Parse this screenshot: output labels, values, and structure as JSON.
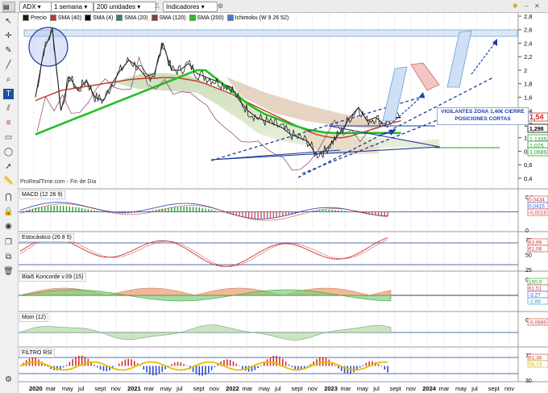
{
  "toolbar": {
    "symbol": "ADX",
    "period": "1 semana",
    "units": "200 unidades",
    "indicators_label": "Indicadores"
  },
  "legend": [
    "Precio",
    "SMA (40)",
    "SMA (4)",
    "SMA (20)",
    "SMA (120)",
    "SMA (200)",
    "Ichimoku (W 9 26 52)"
  ],
  "legend_colors": [
    "#1a1a1a",
    "#c0392b",
    "#000000",
    "#2e8b57",
    "#8b3a3a",
    "#22c022",
    "#3a7fd0"
  ],
  "annotation": {
    "line1": "VIGILANTES ZONA 1,40€ CIERRE",
    "line2": "POSICIONES CORTAS"
  },
  "source_label": "ProRealTime.com - Fin de Día",
  "price_axis": [
    "2,8",
    "2,6",
    "2,4",
    "2,2",
    "2",
    "1,8",
    "1,6",
    "1,4",
    "1,2",
    "1",
    "0,8",
    "0,6",
    "0,4"
  ],
  "price_tags": [
    {
      "text": "1,54",
      "color": "#d03030"
    },
    {
      "text": "1,298",
      "color": "#000000"
    },
    {
      "text": "1,1335",
      "color": "#22a022"
    },
    {
      "text": "1,075",
      "color": "#22a022"
    },
    {
      "text": "1,0689",
      "color": "#22a022"
    }
  ],
  "panels": [
    {
      "title": "MACD (12 26 9)",
      "axis": [
        "0,1",
        "0"
      ],
      "tags": [
        "0,0434",
        "0,0415",
        "-0,0019"
      ],
      "tag_colors": [
        "#cc3333",
        "#3355cc",
        "#cc3333"
      ]
    },
    {
      "title": "Estocástico (26 8 5)",
      "axis": [
        "75",
        "50",
        "25"
      ],
      "tags": [
        "63,99",
        "61,06"
      ],
      "tag_colors": [
        "#cc3333",
        "#cc3333"
      ]
    },
    {
      "title": "Blai5 Koncorde v.09 (15)",
      "axis": [
        "0"
      ],
      "tags": [
        "100,0",
        "61,51",
        "-3,27",
        "-2,88"
      ],
      "tag_colors": [
        "#22a022",
        "#cc3333",
        "#3355cc",
        "#2a9ad0"
      ]
    },
    {
      "title": "Mom (12)",
      "axis": [
        "0"
      ],
      "tags": [
        "-0,0689"
      ],
      "tag_colors": [
        "#cc3333"
      ]
    },
    {
      "title": "FILTRO RSI",
      "axis": [
        "70",
        "30"
      ],
      "tags": [
        "61,36",
        "59,73"
      ],
      "tag_colors": [
        "#cc3333",
        "#c8b400"
      ]
    }
  ],
  "time_axis": [
    "2020",
    "mar",
    "may",
    "jul",
    "sept",
    "nov",
    "2021",
    "mar",
    "may",
    "jul",
    "sept",
    "nov",
    "2022",
    "mar",
    "may",
    "jul",
    "sept",
    "nov",
    "2023",
    "mar",
    "may",
    "jul",
    "sept",
    "nov",
    "2024",
    "mar",
    "may",
    "jul",
    "sept",
    "nov"
  ],
  "chart_data": {
    "type": "line",
    "title": "ADX",
    "xlabel": "",
    "ylabel": "",
    "ylim": [
      0.4,
      2.8
    ],
    "grid": true,
    "x": [
      "2020-01",
      "2020-02",
      "2020-03",
      "2020-04",
      "2020-05",
      "2020-06",
      "2020-07",
      "2020-08",
      "2020-09",
      "2020-10",
      "2020-11",
      "2020-12",
      "2021-01",
      "2021-02",
      "2021-03",
      "2021-04",
      "2021-05",
      "2021-06",
      "2021-07",
      "2021-08",
      "2021-09",
      "2021-10",
      "2021-11",
      "2021-12",
      "2022-01",
      "2022-02",
      "2022-03",
      "2022-04",
      "2022-05",
      "2022-06",
      "2022-07",
      "2022-08",
      "2022-09",
      "2022-10",
      "2022-11",
      "2022-12",
      "2023-01",
      "2023-02",
      "2023-03",
      "2023-04",
      "2023-05",
      "2023-06",
      "2023-07",
      "2023-08"
    ],
    "series": [
      {
        "name": "Precio",
        "values": [
          1.6,
          2.3,
          2.6,
          1.4,
          1.9,
          1.7,
          1.85,
          1.6,
          1.55,
          1.8,
          2.0,
          2.15,
          2.05,
          1.9,
          1.95,
          2.4,
          2.0,
          2.0,
          2.1,
          1.95,
          1.9,
          1.85,
          1.8,
          1.75,
          1.55,
          1.4,
          1.3,
          1.25,
          1.2,
          1.15,
          1.05,
          1.0,
          0.95,
          0.75,
          0.8,
          0.95,
          1.1,
          1.3,
          1.45,
          1.25,
          1.3,
          1.2,
          1.3,
          1.3
        ]
      },
      {
        "name": "SMA (40)",
        "values": [
          1.55,
          1.6,
          1.65,
          1.7,
          1.72,
          1.74,
          1.76,
          1.78,
          1.8,
          1.82,
          1.84,
          1.86,
          1.87,
          1.88,
          1.88,
          1.89,
          1.89,
          1.88,
          1.86,
          1.84,
          1.8,
          1.75,
          1.7,
          1.65,
          1.58,
          1.52,
          1.46,
          1.4,
          1.34,
          1.28,
          1.22,
          1.16,
          1.1,
          1.05,
          1.02,
          1.0,
          1.0,
          1.02,
          1.06,
          1.1,
          1.14,
          1.18,
          1.22,
          1.25
        ]
      },
      {
        "name": "SMA (200)",
        "values": [
          1.05,
          1.1,
          1.15,
          1.2,
          1.25,
          1.3,
          1.35,
          1.4,
          1.45,
          1.5,
          1.55,
          1.6,
          1.65,
          1.7,
          1.75,
          1.8,
          1.85,
          1.9,
          1.95,
          2.0,
          2.0,
          1.9,
          1.8,
          1.7,
          1.6,
          1.5,
          1.42,
          1.35,
          1.3,
          1.25,
          1.2,
          1.16,
          1.12,
          1.1,
          1.08,
          1.07,
          1.07,
          1.07,
          1.07,
          1.07,
          1.07,
          1.07,
          1.07,
          1.07
        ]
      }
    ],
    "price_tags": [
      1.54,
      1.298,
      1.1335,
      1.075,
      1.0689
    ],
    "annotation_level": 1.4
  }
}
